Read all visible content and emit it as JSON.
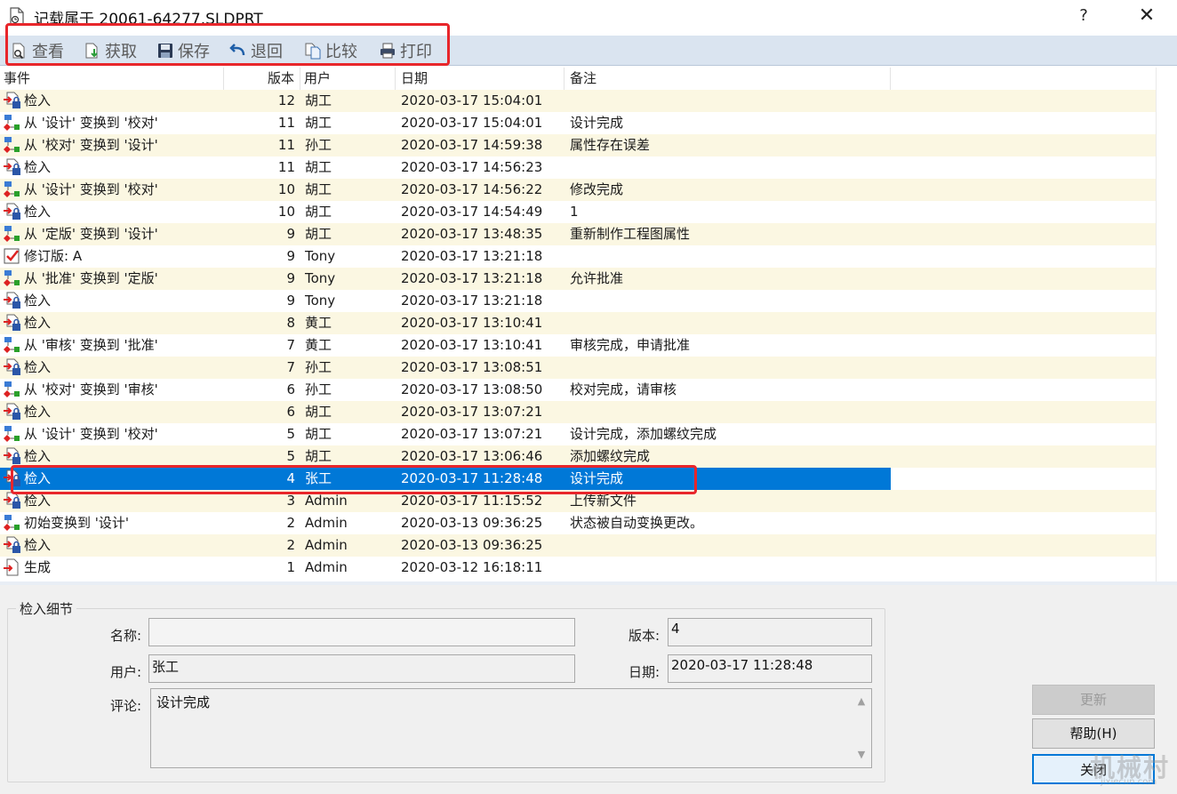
{
  "window": {
    "title": "记载属于 20061-64277.SLDPRT",
    "help_label": "?",
    "close_label": "✕"
  },
  "toolbar": {
    "items": [
      {
        "label": "查看",
        "icon": "view-icon"
      },
      {
        "label": "获取",
        "icon": "get-icon"
      },
      {
        "label": "保存",
        "icon": "save-icon"
      },
      {
        "label": "退回",
        "icon": "rollback-icon"
      },
      {
        "label": "比较",
        "icon": "compare-icon"
      },
      {
        "label": "打印",
        "icon": "print-icon"
      }
    ]
  },
  "list": {
    "columns": [
      "事件",
      "版本",
      "用户",
      "日期",
      "备注"
    ],
    "rows": [
      {
        "icon": "checkin-icon",
        "event": "检入",
        "version": "12",
        "user": "胡工",
        "date": "2020-03-17 15:04:01",
        "note": ""
      },
      {
        "icon": "transition-icon",
        "event": "从 '设计' 变换到 '校对'",
        "version": "11",
        "user": "胡工",
        "date": "2020-03-17 15:04:01",
        "note": "设计完成"
      },
      {
        "icon": "transition-icon",
        "event": "从 '校对' 变换到 '设计'",
        "version": "11",
        "user": "孙工",
        "date": "2020-03-17 14:59:38",
        "note": "属性存在误差"
      },
      {
        "icon": "checkin-icon",
        "event": "检入",
        "version": "11",
        "user": "胡工",
        "date": "2020-03-17 14:56:23",
        "note": ""
      },
      {
        "icon": "transition-icon",
        "event": "从 '设计' 变换到 '校对'",
        "version": "10",
        "user": "胡工",
        "date": "2020-03-17 14:56:22",
        "note": "修改完成"
      },
      {
        "icon": "checkin-icon",
        "event": "检入",
        "version": "10",
        "user": "胡工",
        "date": "2020-03-17 14:54:49",
        "note": "1"
      },
      {
        "icon": "transition-icon",
        "event": "从 '定版' 变换到 '设计'",
        "version": "9",
        "user": "胡工",
        "date": "2020-03-17 13:48:35",
        "note": "重新制作工程图属性"
      },
      {
        "icon": "revision-icon",
        "event": "修订版: A",
        "version": "9",
        "user": "Tony",
        "date": "2020-03-17 13:21:18",
        "note": ""
      },
      {
        "icon": "transition-icon",
        "event": "从 '批准' 变换到 '定版'",
        "version": "9",
        "user": "Tony",
        "date": "2020-03-17 13:21:18",
        "note": "允许批准"
      },
      {
        "icon": "checkin-icon",
        "event": "检入",
        "version": "9",
        "user": "Tony",
        "date": "2020-03-17 13:21:18",
        "note": ""
      },
      {
        "icon": "checkin-icon",
        "event": "检入",
        "version": "8",
        "user": "黄工",
        "date": "2020-03-17 13:10:41",
        "note": ""
      },
      {
        "icon": "transition-icon",
        "event": "从 '审核' 变换到 '批准'",
        "version": "7",
        "user": "黄工",
        "date": "2020-03-17 13:10:41",
        "note": "审核完成，申请批准"
      },
      {
        "icon": "checkin-icon",
        "event": "检入",
        "version": "7",
        "user": "孙工",
        "date": "2020-03-17 13:08:51",
        "note": ""
      },
      {
        "icon": "transition-icon",
        "event": "从 '校对' 变换到 '审核'",
        "version": "6",
        "user": "孙工",
        "date": "2020-03-17 13:08:50",
        "note": "校对完成，请审核"
      },
      {
        "icon": "checkin-icon",
        "event": "检入",
        "version": "6",
        "user": "胡工",
        "date": "2020-03-17 13:07:21",
        "note": ""
      },
      {
        "icon": "transition-icon",
        "event": "从 '设计' 变换到 '校对'",
        "version": "5",
        "user": "胡工",
        "date": "2020-03-17 13:07:21",
        "note": "设计完成，添加螺纹完成"
      },
      {
        "icon": "checkin-icon",
        "event": "检入",
        "version": "5",
        "user": "胡工",
        "date": "2020-03-17 13:06:46",
        "note": "添加螺纹完成"
      },
      {
        "icon": "checkin-icon",
        "event": "检入",
        "version": "4",
        "user": "张工",
        "date": "2020-03-17 11:28:48",
        "note": "设计完成",
        "selected": true
      },
      {
        "icon": "checkin-icon",
        "event": "检入",
        "version": "3",
        "user": "Admin",
        "date": "2020-03-17 11:15:52",
        "note": "上传新文件"
      },
      {
        "icon": "transition-icon",
        "event": "初始变换到 '设计'",
        "version": "2",
        "user": "Admin",
        "date": "2020-03-13 09:36:25",
        "note": "状态被自动变换更改。"
      },
      {
        "icon": "checkin-icon",
        "event": "检入",
        "version": "2",
        "user": "Admin",
        "date": "2020-03-13 09:36:25",
        "note": ""
      },
      {
        "icon": "create-icon",
        "event": "生成",
        "version": "1",
        "user": "Admin",
        "date": "2020-03-12 16:18:11",
        "note": ""
      }
    ]
  },
  "details": {
    "group_title": "检入细节",
    "name_label": "名称:",
    "name_value": "",
    "version_label": "版本:",
    "version_value": "4",
    "user_label": "用户:",
    "user_value": "张工",
    "date_label": "日期:",
    "date_value": "2020-03-17 11:28:48",
    "comment_label": "评论:",
    "comment_value": "设计完成"
  },
  "buttons": {
    "update": "更新",
    "help": "帮助(H)",
    "close": "关闭"
  },
  "watermark": {
    "text": "机械村",
    "sub": "jixiecun.com"
  },
  "colors": {
    "selection": "#0078d7",
    "highlight_box": "#e8262b",
    "toolbar_bg": "#dae4f0",
    "alt_row": "#fbf7e2"
  }
}
